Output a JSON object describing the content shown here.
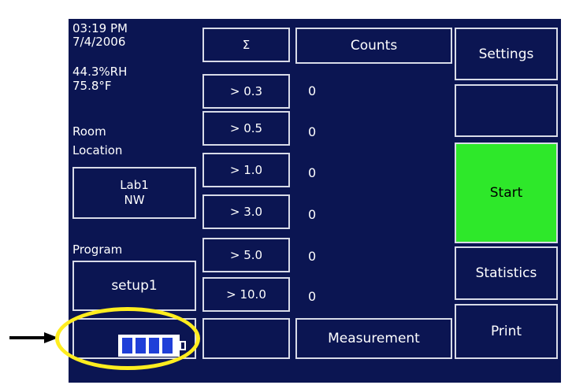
{
  "status": {
    "time": "03:19 PM",
    "date": "7/4/2006",
    "humidity": "44.3%RH",
    "temperature": "75.8°F",
    "room_label": "Room"
  },
  "location": {
    "label": "Location",
    "line1": "Lab1",
    "line2": "NW"
  },
  "program": {
    "label": "Program",
    "value": "setup1"
  },
  "table": {
    "sum_header": "Σ",
    "counts_header": "Counts",
    "rows": [
      {
        "size": "> 0.3",
        "count": "0"
      },
      {
        "size": "> 0.5",
        "count": "0"
      },
      {
        "size": "> 1.0",
        "count": "0"
      },
      {
        "size": "> 3.0",
        "count": "0"
      },
      {
        "size": "> 5.0",
        "count": "0"
      },
      {
        "size": "> 10.0",
        "count": "0"
      }
    ],
    "measurement_label": "Measurement"
  },
  "actions": {
    "settings": "Settings",
    "start": "Start",
    "statistics": "Statistics",
    "print": "Print"
  },
  "battery": {
    "icon": "battery-icon",
    "level_fraction": 1.0,
    "bars": 4
  },
  "colors": {
    "screen_bg": "#0b1552",
    "start_bg": "#2ee82a",
    "highlight": "#ffed1f",
    "border": "#d8dbe8"
  }
}
